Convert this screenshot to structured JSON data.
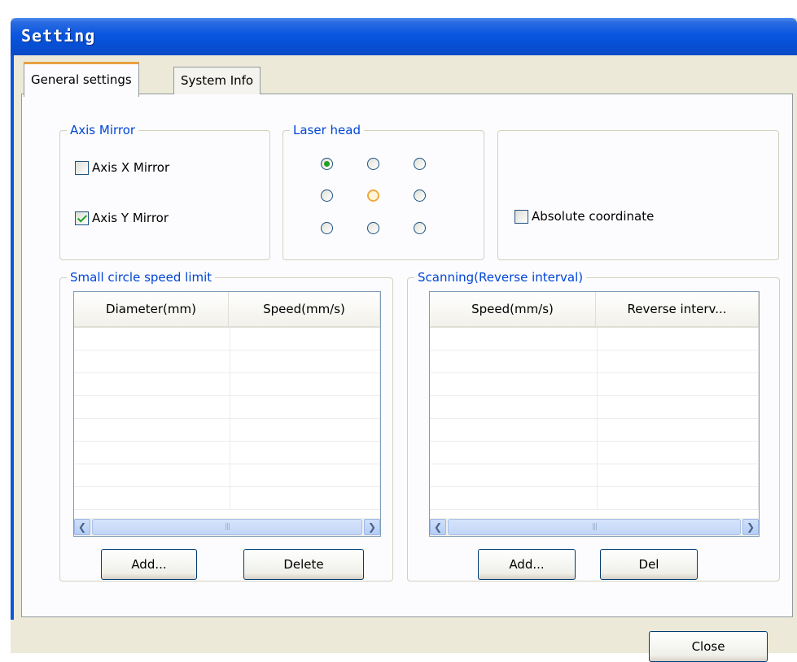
{
  "window": {
    "title": "Setting"
  },
  "tabs": [
    {
      "label": "General settings",
      "active": true
    },
    {
      "label": "System Info",
      "active": false
    }
  ],
  "axis_mirror": {
    "title": "Axis Mirror",
    "x_mirror": {
      "label": "Axis X Mirror",
      "checked": false
    },
    "y_mirror": {
      "label": "Axis Y Mirror",
      "checked": true
    }
  },
  "laser_head": {
    "title": "Laser head",
    "selected_index": 0,
    "highlighted_index": 4
  },
  "coordinate": {
    "absolute": {
      "label": "Absolute coordinate",
      "checked": false
    }
  },
  "small_circle": {
    "title": "Small circle speed limit",
    "columns": [
      "Diameter(mm)",
      "Speed(mm/s)"
    ],
    "add_label": "Add...",
    "delete_label": "Delete"
  },
  "scanning": {
    "title": "Scanning(Reverse interval)",
    "columns": [
      "Speed(mm/s)",
      "Reverse interv..."
    ],
    "add_label": "Add...",
    "del_label": "Del"
  },
  "footer": {
    "close_label": "Close"
  },
  "icons": {
    "scroll_left": "chevron-left-icon",
    "scroll_right": "chevron-right-icon",
    "scroll_grip": "grip-icon"
  },
  "colors": {
    "titlebar": "#0a56e0",
    "group_title": "#0046d5",
    "check": "#21a121",
    "tab_highlight": "#e8a040"
  }
}
